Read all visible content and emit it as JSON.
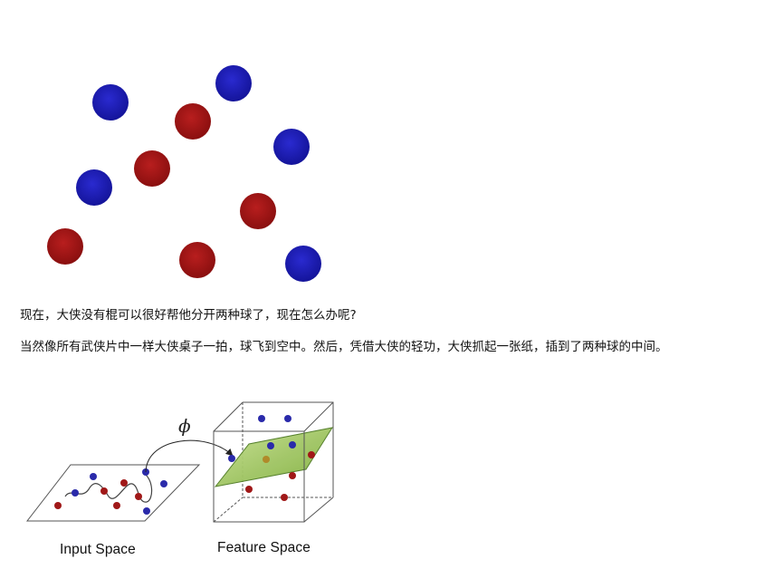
{
  "text": {
    "paragraph_1": "现在，大侠没有棍可以很好帮他分开两种球了，现在怎么办呢?",
    "paragraph_2": "当然像所有武侠片中一样大侠桌子一拍，球飞到空中。然后，凭借大侠的轻功，大侠抓起一张纸，插到了两种球的中间。"
  },
  "diagram": {
    "phi_symbol": "ϕ",
    "input_space_label": "Input Space",
    "feature_space_label": "Feature Space"
  },
  "colors": {
    "blue_ball": "#1e1eb4",
    "red_ball": "#a01414",
    "plane": "#9cc85a"
  }
}
